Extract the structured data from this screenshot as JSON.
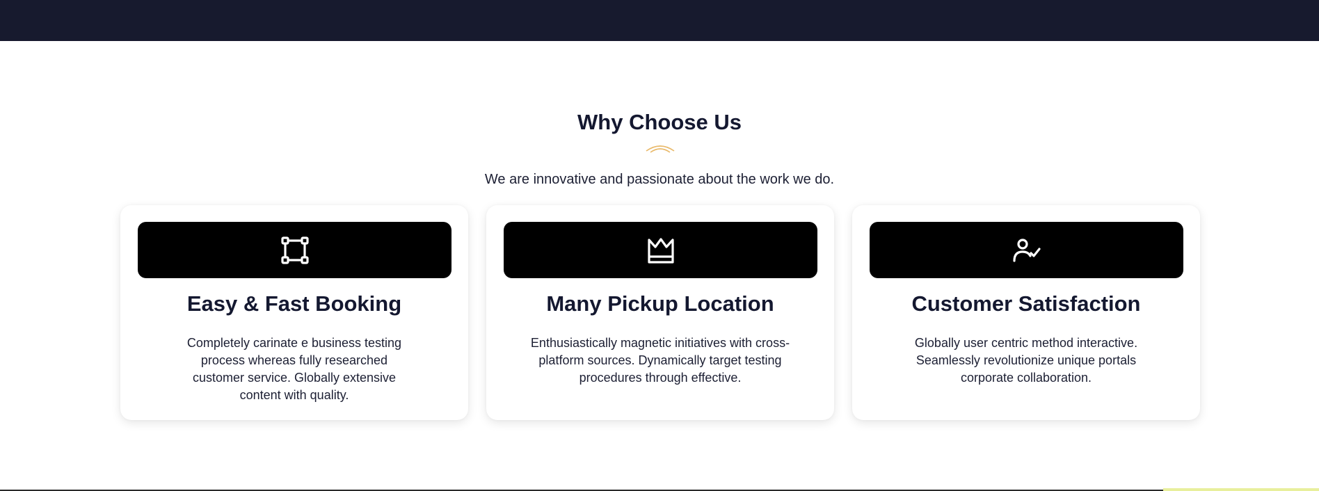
{
  "section": {
    "title": "Why Choose Us",
    "subtitle": "We are innovative and passionate about the work we do."
  },
  "colors": {
    "accent": "#e9b96a",
    "topbar": "#171a2e",
    "icon_box": "#000000",
    "text": "#141830"
  },
  "features": [
    {
      "icon": "selection-frame-icon",
      "title": "Easy & Fast Booking",
      "description": "Completely carinate e business testing process whereas fully researched customer service. Globally extensive content with quality."
    },
    {
      "icon": "crown-icon",
      "title": "Many Pickup Location",
      "description": "Enthusiastically magnetic initiatives with cross-platform sources. Dynamically target testing procedures through effective."
    },
    {
      "icon": "user-check-icon",
      "title": "Customer Satisfaction",
      "description": "Globally user centric method interactive. Seamlessly revolutionize unique portals corporate collaboration."
    }
  ]
}
